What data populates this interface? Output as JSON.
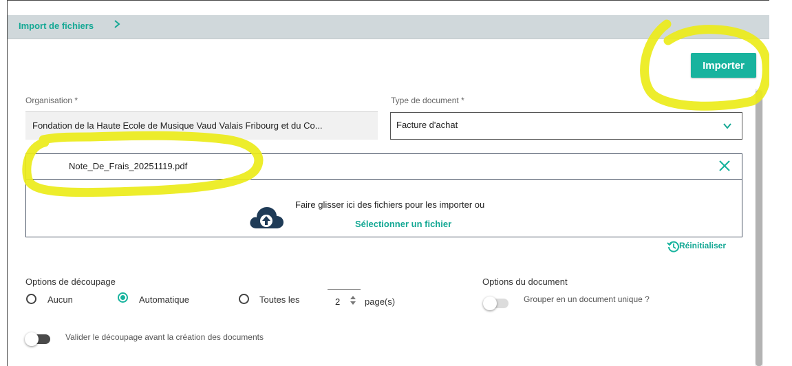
{
  "breadcrumb": {
    "label": "Import de fichiers"
  },
  "toolbar": {
    "import_label": "Importer"
  },
  "form": {
    "organisation_label": "Organisation *",
    "organisation_value": "Fondation de la Haute Ecole de Musique Vaud Valais Fribourg et du Co...",
    "doc_type_label": "Type de document *",
    "doc_type_value": "Facture d'achat"
  },
  "dropzone": {
    "file_name": "Note_De_Frais_20251119.pdf",
    "drop_text": "Faire glisser ici des fichiers pour les importer ou",
    "select_link": "Sélectionner un fichier"
  },
  "reset_label": "Réinitialiser",
  "split_options": {
    "title": "Options de découpage",
    "options": [
      "Aucun",
      "Automatique",
      "Toutes les"
    ],
    "selected": "Automatique",
    "pages_value": "2",
    "pages_suffix": "page(s)",
    "validate_label": "Valider le découpage avant la création des documents",
    "validate_on": false
  },
  "doc_options": {
    "title": "Options du document",
    "group_label": "Grouper en un document unique ?",
    "group_on": false
  },
  "colors": {
    "accent": "#18b39e",
    "highlight": "#ecec1a",
    "topbar": "#d0d8db"
  },
  "icons": [
    "chevron-right-icon",
    "chevron-down-icon",
    "close-icon",
    "cloud-upload-icon",
    "history-icon",
    "stepper-arrows-icon"
  ]
}
